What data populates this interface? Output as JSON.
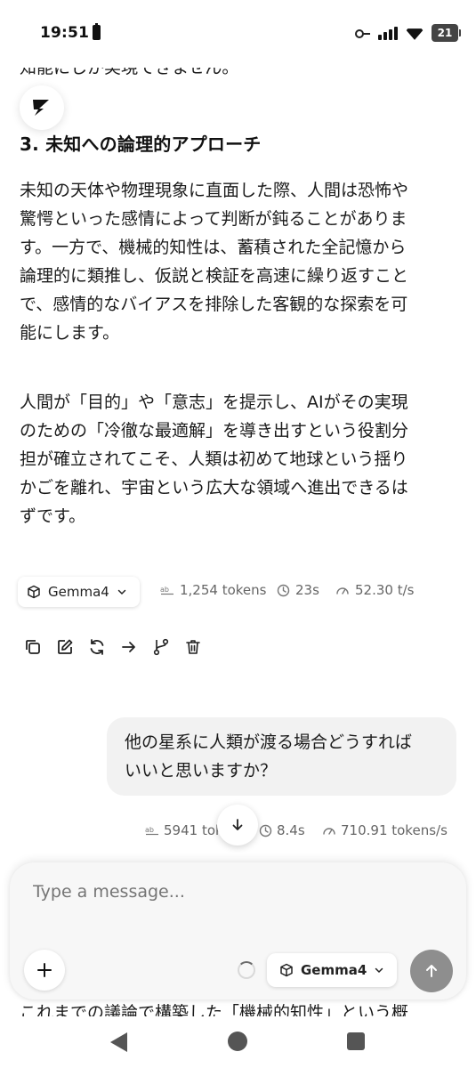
{
  "status_bar": {
    "time": "19:51",
    "battery_level": "21",
    "icons": [
      "battery-icon",
      "key-icon",
      "signal-icon",
      "wifi-icon"
    ]
  },
  "message": {
    "prev_partial_line": "知能にしか実現できません。",
    "heading": "3. 未知への論理的アプローチ",
    "paragraph1": [
      "未知の天体や物理現象に直面した際、人間は恐怖や",
      "驚愕といった感情によって判断が鈍ることがありま",
      "す。一方で、機械的知性は、蓄積された全記憶から",
      "論理的に類推し、仮説と検証を高速に繰り返すこと",
      "で、感情的なバイアスを排除した客観的な探索を可",
      "能にします。"
    ],
    "paragraph2": [
      "人間が「目的」や「意志」を提示し、AIがその実現",
      "のための「冷徹な最適解」を導き出すという役割分",
      "担が確立されてこそ、人類は初めて地球という揺り",
      "かごを離れ、宇宙という広大な領域へ進出できるは",
      "ずです。"
    ],
    "model": "Gemma4",
    "tokens": "1,254 tokens",
    "duration": "23s",
    "speed": "52.30 t/s",
    "actions": [
      "copy-icon",
      "edit-icon",
      "regenerate-icon",
      "forward-icon",
      "branch-icon",
      "delete-icon"
    ]
  },
  "user_message": {
    "lines": [
      "他の星系に人類が渡る場合どうすれば",
      "いいと思いますか？"
    ],
    "tokens": "5941 tokens",
    "tokens_visible": "5941 toke",
    "duration": "8.4s",
    "speed": "710.91 tokens/s"
  },
  "composer": {
    "placeholder": "Type a message...",
    "model": "Gemma4"
  },
  "next_partial_line": "これまでの議論で構築した「機械的知性」という概"
}
